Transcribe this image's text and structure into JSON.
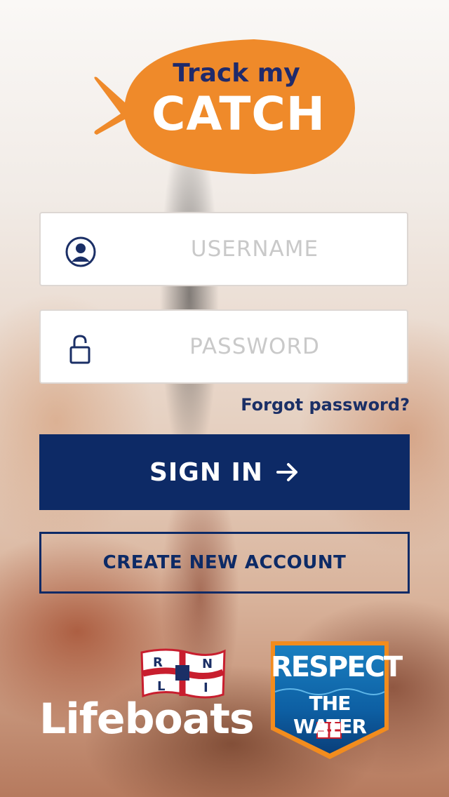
{
  "logo": {
    "line1": "Track my",
    "line2": "CATCH",
    "fish_color": "#ef8a2a",
    "text_color": "#1f2a6b"
  },
  "username": {
    "placeholder": "USERNAME",
    "value": "",
    "icon": "user-icon"
  },
  "password": {
    "placeholder": "PASSWORD",
    "value": "",
    "icon": "unlock-icon"
  },
  "forgot_password": "Forgot password?",
  "sign_in": {
    "label": "SIGN IN",
    "icon": "arrow-right-icon",
    "color": "#0d2a66"
  },
  "create_account": "CREATE NEW ACCOUNT",
  "footer": {
    "rnli_flag_letters": [
      "R",
      "N",
      "L",
      "I"
    ],
    "lifeboats": "Lifeboats",
    "badge_line1": "RESPECT",
    "badge_line2": "THE WATER"
  }
}
